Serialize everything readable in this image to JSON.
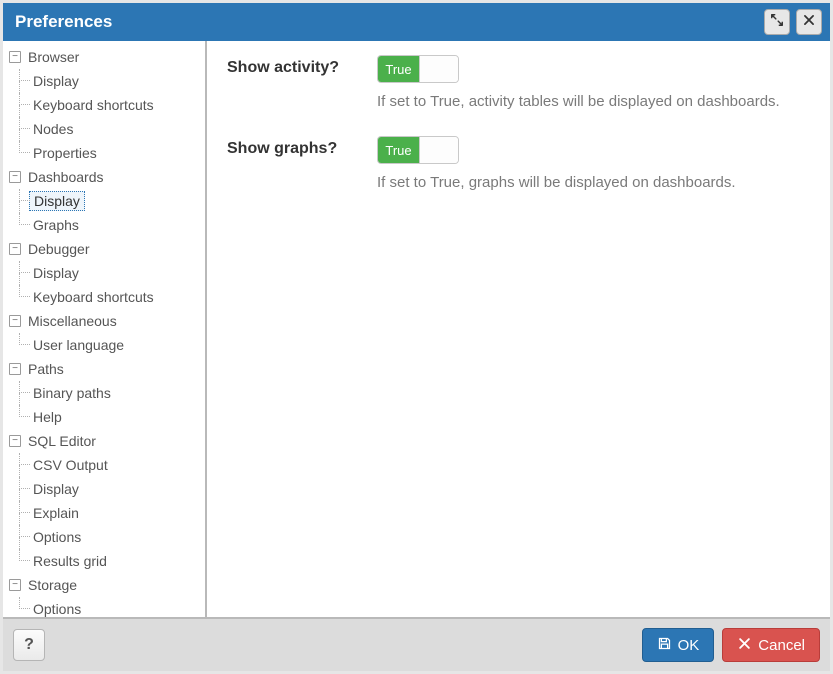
{
  "window": {
    "title": "Preferences"
  },
  "tree": {
    "groups": [
      {
        "label": "Browser",
        "children": [
          "Display",
          "Keyboard shortcuts",
          "Nodes",
          "Properties"
        ]
      },
      {
        "label": "Dashboards",
        "children": [
          "Display",
          "Graphs"
        ]
      },
      {
        "label": "Debugger",
        "children": [
          "Display",
          "Keyboard shortcuts"
        ]
      },
      {
        "label": "Miscellaneous",
        "children": [
          "User language"
        ]
      },
      {
        "label": "Paths",
        "children": [
          "Binary paths",
          "Help"
        ]
      },
      {
        "label": "SQL Editor",
        "children": [
          "CSV Output",
          "Display",
          "Explain",
          "Options",
          "Results grid"
        ]
      },
      {
        "label": "Storage",
        "children": [
          "Options"
        ]
      }
    ],
    "selected": {
      "group": 1,
      "child": 0
    }
  },
  "settings": [
    {
      "key": "show_activity",
      "label": "Show activity?",
      "value": "True",
      "description": "If set to True, activity tables will be displayed on dashboards."
    },
    {
      "key": "show_graphs",
      "label": "Show graphs?",
      "value": "True",
      "description": "If set to True, graphs will be displayed on dashboards."
    }
  ],
  "footer": {
    "help": "?",
    "ok": "OK",
    "cancel": "Cancel"
  },
  "toggle_glyph": "−"
}
